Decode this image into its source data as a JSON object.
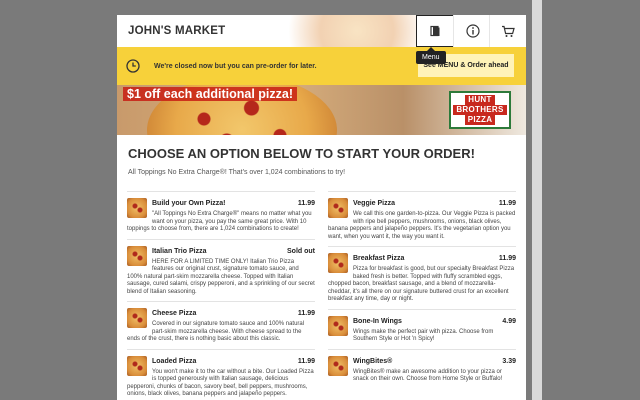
{
  "header": {
    "store_name": "JOHN'S MARKET",
    "menu_tooltip": "Menu"
  },
  "notice": {
    "message": "We're closed now but you can pre-order for later.",
    "cta": "See MENU & Order ahead"
  },
  "banner": {
    "promo": "$1 off each additional pizza!",
    "logo_lines": [
      "HUNT",
      "BROTHERS",
      "PIZZA"
    ]
  },
  "main": {
    "title": "CHOOSE AN OPTION BELOW TO START YOUR ORDER!",
    "subtitle": "All Toppings No Extra Charge®! That's over 1,024 combinations to try!"
  },
  "menu": {
    "left": [
      {
        "name": "Build your Own Pizza!",
        "price": "11.99",
        "desc": "\"All Toppings No Extra Charge®\" means no matter what you want on your pizza, you pay the same great price. With 10 toppings to choose from, there are 1,024 combinations to create!"
      },
      {
        "name": "Italian Trio Pizza",
        "price": "Sold out",
        "desc": "HERE FOR A LIMITED TIME ONLY! Italian Trio Pizza features our original crust, signature tomato sauce, and 100% natural part-skim mozzarella cheese. Topped with Italian sausage, cured salami, crispy pepperoni, and a sprinkling of our secret blend of Italian seasoning."
      },
      {
        "name": "Cheese Pizza",
        "price": "11.99",
        "desc": "Covered in our signature tomato sauce and 100% natural part-skim mozzarella cheese. With cheese spread to the ends of the crust, there is nothing basic about this classic."
      },
      {
        "name": "Loaded Pizza",
        "price": "11.99",
        "desc": "You won't make it to the car without a bite. Our Loaded Pizza is topped generously with Italian sausage, delicious pepperoni, chunks of bacon, savory beef, bell peppers, mushrooms, onions, black olives, banana peppers and jalapeño peppers."
      }
    ],
    "right": [
      {
        "name": "Veggie Pizza",
        "price": "11.99",
        "desc": "We call this one garden-to-pizza. Our Veggie Pizza is packed with ripe bell peppers, mushrooms, onions, black olives, banana peppers and jalapeño peppers. It's the vegetarian option you want, when you want it, the way you want it."
      },
      {
        "name": "Breakfast Pizza",
        "price": "11.99",
        "desc": "Pizza for breakfast is good, but our specialty Breakfast Pizza baked fresh is better. Topped with fluffy scrambled eggs, chopped bacon, breakfast sausage, and a blend of mozzarella-cheddar, it's all there on our signature buttered crust for an excellent breakfast any time, day or night."
      },
      {
        "name": "Bone-In Wings",
        "price": "4.99",
        "desc": "Wings make the perfect pair with pizza. Choose from Southern Style or Hot 'n Spicy!"
      },
      {
        "name": "WingBites®",
        "price": "3.39",
        "desc": "WingBites® make an awesome addition to your pizza or snack on their own. Choose from Home Style or Buffalo!"
      }
    ]
  },
  "colors": {
    "notice_bg": "#f7d13a",
    "accent_red": "#c8281e",
    "logo_green": "#2d7a3a"
  }
}
